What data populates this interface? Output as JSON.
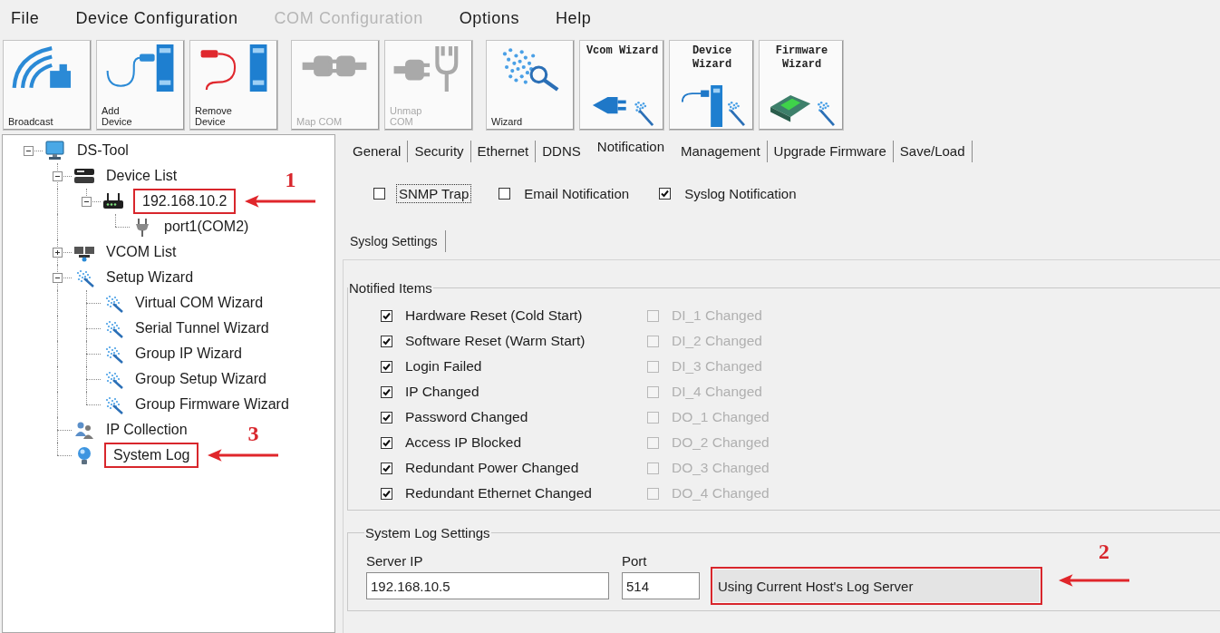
{
  "menu": [
    {
      "label": "File",
      "disabled": false
    },
    {
      "label": "Device Configuration",
      "disabled": false
    },
    {
      "label": "COM Configuration",
      "disabled": true
    },
    {
      "label": "Options",
      "disabled": false
    },
    {
      "label": "Help",
      "disabled": false
    }
  ],
  "toolbar": [
    {
      "label": "Broadcast",
      "kind": "broadcast",
      "disabled": false
    },
    {
      "label": "Add Device",
      "kind": "add-device",
      "disabled": false
    },
    {
      "label": "Remove Device",
      "kind": "remove-device",
      "disabled": false
    },
    {
      "label": "Map COM",
      "kind": "map-com",
      "disabled": true
    },
    {
      "label": "Unmap COM",
      "kind": "unmap-com",
      "disabled": true
    },
    {
      "label": "Wizard",
      "kind": "wizard",
      "disabled": false
    },
    {
      "label": "Vcom Wizard",
      "kind": "vcom-wizard",
      "disabled": false
    },
    {
      "label": "Device Wizard",
      "kind": "device-wizard",
      "disabled": false
    },
    {
      "label": "Firmware Wizard",
      "kind": "firmware-wizard",
      "disabled": false
    }
  ],
  "tree": {
    "label": "DS-Tool",
    "kind": "computer",
    "expanded": true,
    "children": [
      {
        "label": "Device List",
        "kind": "device-list",
        "expanded": true,
        "children": [
          {
            "label": "192.168.10.2",
            "kind": "device",
            "expanded": true,
            "callout": "1",
            "children": [
              {
                "label": "port1(COM2)",
                "kind": "port"
              }
            ]
          }
        ]
      },
      {
        "label": "VCOM List",
        "kind": "vcom-list",
        "expanded": false
      },
      {
        "label": "Setup Wizard",
        "kind": "wizard",
        "expanded": true,
        "children": [
          {
            "label": "Virtual COM Wizard",
            "kind": "wizard"
          },
          {
            "label": "Serial Tunnel Wizard",
            "kind": "wizard"
          },
          {
            "label": "Group IP Wizard",
            "kind": "wizard"
          },
          {
            "label": "Group Setup Wizard",
            "kind": "wizard"
          },
          {
            "label": "Group Firmware Wizard",
            "kind": "wizard"
          }
        ]
      },
      {
        "label": "IP Collection",
        "kind": "ip-collection"
      },
      {
        "label": "System Log",
        "kind": "system-log",
        "callout": "3"
      }
    ]
  },
  "tabs": [
    {
      "label": "General",
      "selected": false
    },
    {
      "label": "Security",
      "selected": false
    },
    {
      "label": "Ethernet",
      "selected": false
    },
    {
      "label": "DDNS",
      "selected": false
    },
    {
      "label": "Notification",
      "selected": true
    },
    {
      "label": "Management",
      "selected": false
    },
    {
      "label": "Upgrade Firmware",
      "selected": false
    },
    {
      "label": "Save/Load",
      "selected": false
    }
  ],
  "notification_types": [
    {
      "label": "SNMP Trap",
      "checked": false,
      "focused": true
    },
    {
      "label": "Email Notification",
      "checked": false,
      "focused": false
    },
    {
      "label": "Syslog Notification",
      "checked": true,
      "focused": false
    }
  ],
  "sub_tabs": [
    {
      "label": "Syslog Settings",
      "selected": true
    }
  ],
  "notified_items": {
    "title": "Notified Items",
    "columns": [
      {
        "items": [
          {
            "label": "Hardware Reset (Cold Start)",
            "checked": true,
            "disabled": false
          },
          {
            "label": "Software Reset (Warm Start)",
            "checked": true,
            "disabled": false
          },
          {
            "label": "Login Failed",
            "checked": true,
            "disabled": false
          },
          {
            "label": "IP Changed",
            "checked": true,
            "disabled": false
          },
          {
            "label": "Password Changed",
            "checked": true,
            "disabled": false
          },
          {
            "label": "Access IP Blocked",
            "checked": true,
            "disabled": false
          },
          {
            "label": "Redundant Power Changed",
            "checked": true,
            "disabled": false
          },
          {
            "label": "Redundant Ethernet Changed",
            "checked": true,
            "disabled": false
          }
        ]
      },
      {
        "items": [
          {
            "label": "DI_1 Changed",
            "checked": false,
            "disabled": true
          },
          {
            "label": "DI_2 Changed",
            "checked": false,
            "disabled": true
          },
          {
            "label": "DI_3 Changed",
            "checked": false,
            "disabled": true
          },
          {
            "label": "DI_4 Changed",
            "checked": false,
            "disabled": true
          },
          {
            "label": "DO_1 Changed",
            "checked": false,
            "disabled": true
          },
          {
            "label": "DO_2 Changed",
            "checked": false,
            "disabled": true
          },
          {
            "label": "DO_3 Changed",
            "checked": false,
            "disabled": true
          },
          {
            "label": "DO_4 Changed",
            "checked": false,
            "disabled": true
          }
        ]
      }
    ]
  },
  "system_log_settings": {
    "title": "System Log Settings",
    "server_ip": {
      "label": "Server IP",
      "value": "192.168.10.5"
    },
    "port": {
      "label": "Port",
      "value": "514"
    },
    "button": {
      "label": "Using Current Host's Log Server",
      "callout": "2"
    }
  }
}
